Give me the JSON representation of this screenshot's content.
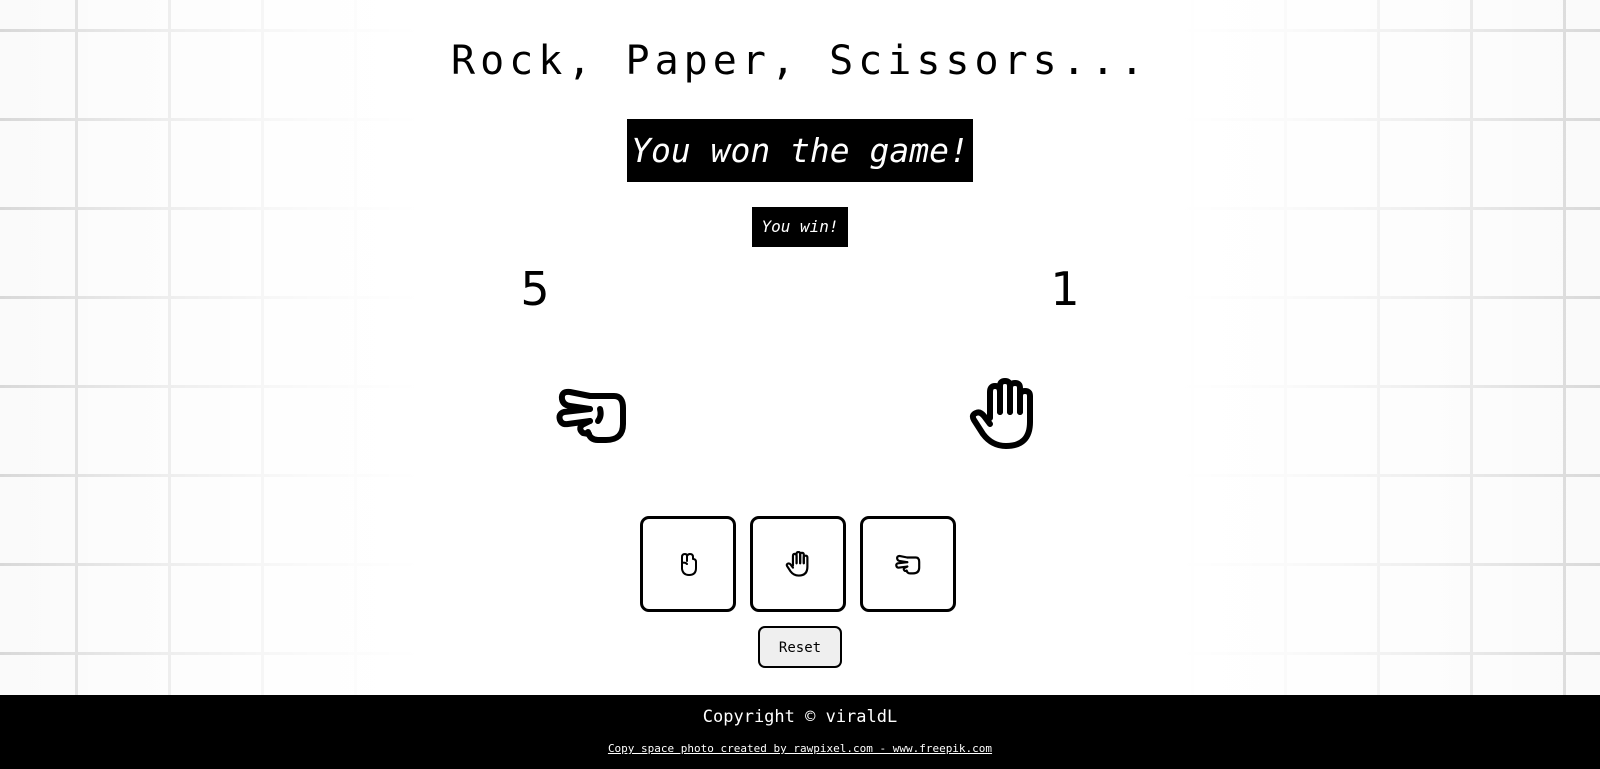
{
  "title": "Rock, Paper, Scissors...",
  "game_result": "You won the game!",
  "round_result": "You win!",
  "scores": {
    "player": "5",
    "computer": "1"
  },
  "hands": {
    "player": "scissors-hand-icon",
    "computer": "paper-hand-icon"
  },
  "choices": [
    {
      "name": "rock",
      "icon": "rock-hand-icon"
    },
    {
      "name": "paper",
      "icon": "paper-hand-icon"
    },
    {
      "name": "scissors",
      "icon": "scissors-hand-icon"
    }
  ],
  "reset_label": "Reset",
  "footer": {
    "copyright": "Copyright © viraldL",
    "credit": "Copy space photo created by rawpixel.com - www.freepik.com"
  }
}
